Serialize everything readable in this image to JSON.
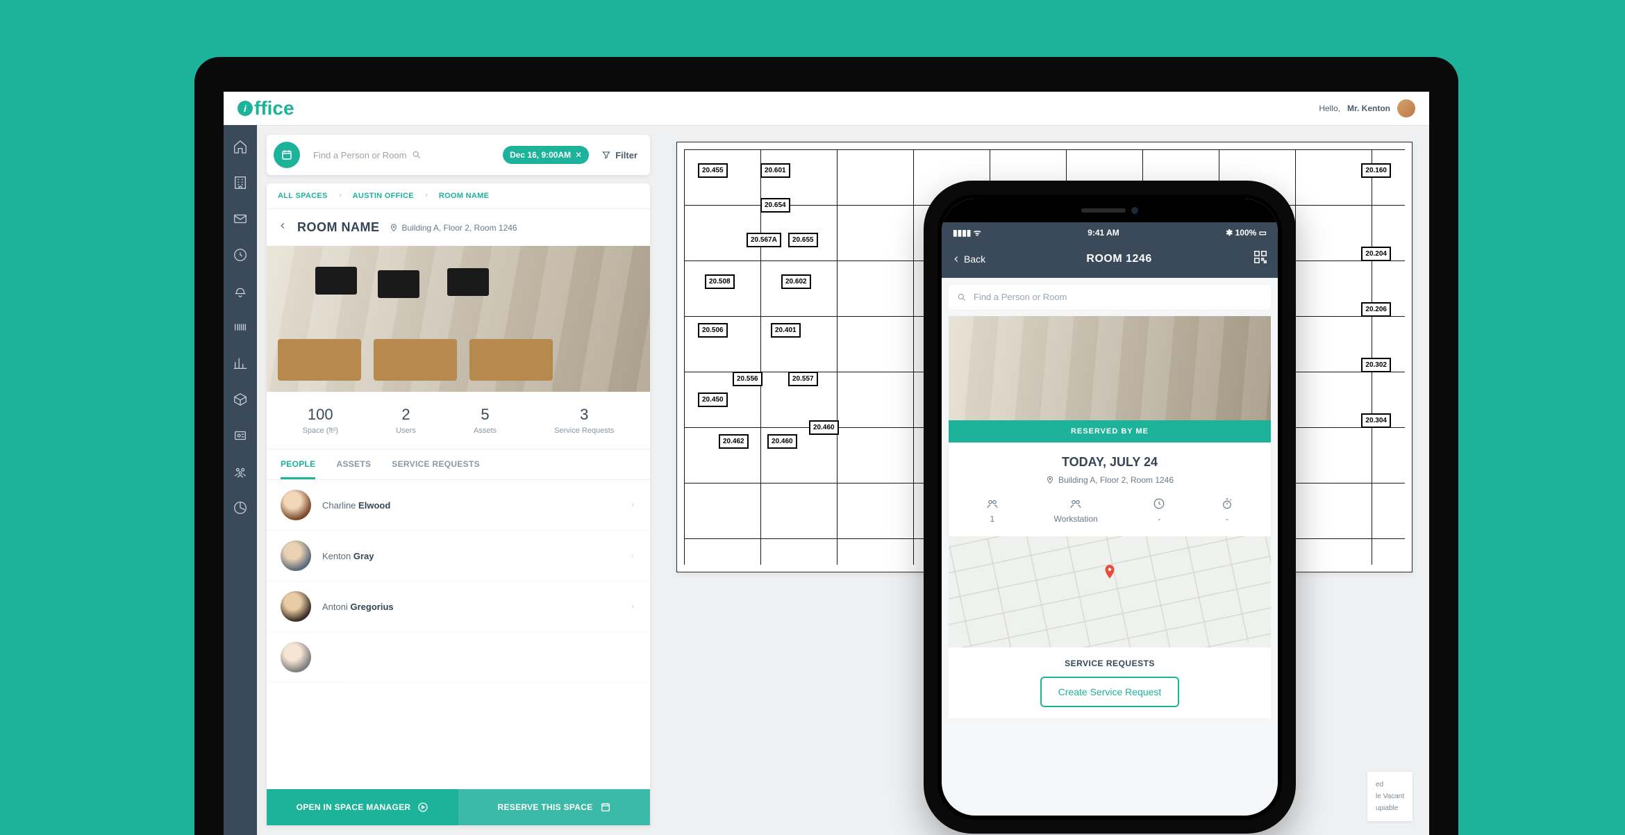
{
  "topbar": {
    "logo_text": "ffice",
    "greeting": "Hello,",
    "user_name": "Mr. Kenton"
  },
  "search": {
    "placeholder": "Find a Person or Room",
    "date_chip": "Dec 16, 9:00AM",
    "filter_label": "Filter"
  },
  "breadcrumb": {
    "a": "ALL SPACES",
    "b": "AUSTIN OFFICE",
    "c": "ROOM NAME"
  },
  "room": {
    "title": "ROOM NAME",
    "location": "Building A, Floor 2, Room 1246"
  },
  "stats": {
    "space_num": "100",
    "space_lbl": "Space (ft²)",
    "users_num": "2",
    "users_lbl": "Users",
    "assets_num": "5",
    "assets_lbl": "Assets",
    "sr_num": "3",
    "sr_lbl": "Service Requests"
  },
  "tabs": {
    "people": "PEOPLE",
    "assets": "ASSETS",
    "service_requests": "SERVICE REQUESTS"
  },
  "people": [
    {
      "first": "Charline",
      "last": "Elwood"
    },
    {
      "first": "Kenton",
      "last": "Gray"
    },
    {
      "first": "Antoni",
      "last": "Gregorius"
    }
  ],
  "actions": {
    "open_manager": "OPEN IN SPACE MANAGER",
    "reserve": "RESERVE THIS SPACE"
  },
  "floor_rooms": [
    "20.455",
    "20.601",
    "20.654",
    "20.567A",
    "20.655",
    "20.508",
    "20.602",
    "20.556",
    "20.557",
    "20.506",
    "20.401",
    "20.450",
    "20.460",
    "20.462",
    "20.460",
    "20.160",
    "20.204",
    "20.206",
    "20.302",
    "20.304"
  ],
  "legend": {
    "a": "ed",
    "b": "le Vacant",
    "c": "upiable"
  },
  "phone": {
    "statusbar": {
      "time": "9:41 AM",
      "battery": "100%"
    },
    "back_label": "Back",
    "title": "ROOM 1246",
    "search_placeholder": "Find a Person or Room",
    "reserved_banner": "RESERVED BY ME",
    "today_title": "TODAY, JULY 24",
    "location": "Building A, Floor 2, Room 1246",
    "stats": {
      "count": "1",
      "type": "Workstation",
      "dash1": "-",
      "dash2": "-"
    },
    "sr_title": "SERVICE REQUESTS",
    "sr_button": "Create Service Request"
  }
}
